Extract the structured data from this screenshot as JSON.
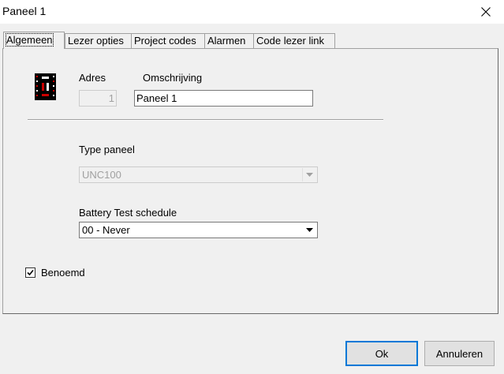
{
  "window": {
    "title": "Paneel 1"
  },
  "tabs": [
    {
      "label": "Algemeen"
    },
    {
      "label": "Lezer opties"
    },
    {
      "label": "Project codes"
    },
    {
      "label": "Alarmen"
    },
    {
      "label": "Code lezer link"
    }
  ],
  "general": {
    "address_label": "Adres",
    "address_value": "1",
    "description_label": "Omschrijving",
    "description_value": "Paneel 1",
    "panel_type_label": "Type paneel",
    "panel_type_value": "UNC100",
    "battery_label": "Battery Test schedule",
    "battery_value": "00 - Never",
    "named_label": "Benoemd",
    "named_checked": true
  },
  "buttons": {
    "ok": "Ok",
    "cancel": "Annuleren"
  },
  "icons": {
    "close": "close-icon",
    "panel": "panel-chip-icon",
    "dropdown": "chevron-down-icon",
    "check": "checkmark-icon"
  }
}
